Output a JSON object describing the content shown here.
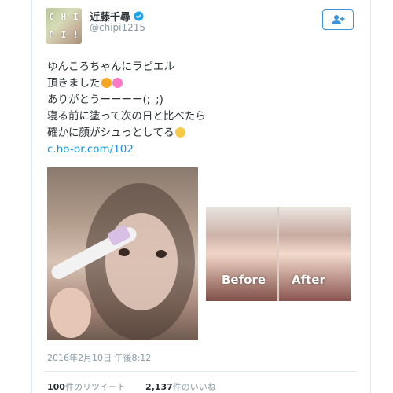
{
  "user": {
    "display_name": "近藤千尋",
    "handle": "@chipi1215",
    "avatar_letters": [
      "C",
      "H",
      "I",
      "P",
      "I",
      "!"
    ]
  },
  "follow_button": {
    "icon": "add-user-icon"
  },
  "tweet": {
    "lines": [
      "ゆんころちゃんにラピエル",
      "頂きました",
      "ありがとうーーーー(;_;)",
      "寝る前に塗って次の日と比べたら",
      "確かに顔がシュっとしてる"
    ],
    "link": "c.ho-br.com/102"
  },
  "images": {
    "before_label": "Before",
    "after_label": "After"
  },
  "timestamp": "2016年2月10日 午後8:12",
  "stats": {
    "retweets_count": "100",
    "retweets_label": "件のリツイート",
    "likes_count": "2,137",
    "likes_label": "件のいいね"
  },
  "colors": {
    "link": "#1b95e0",
    "verified": "#1da1f2",
    "muted": "#8899a6",
    "text": "#292f33"
  }
}
